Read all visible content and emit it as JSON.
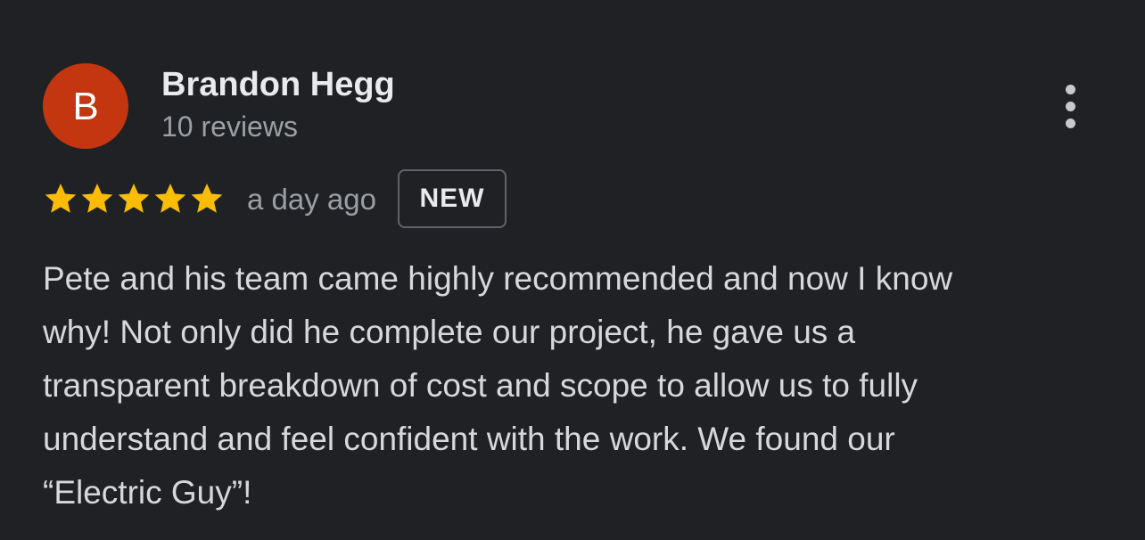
{
  "review": {
    "avatar_initial": "B",
    "reviewer_name": "Brandon Hegg",
    "review_count": "10 reviews",
    "rating": 5,
    "max_rating": 5,
    "time": "a day ago",
    "badge": "NEW",
    "text": "Pete and his team came highly recommended and now I know\nwhy! Not only did he complete our project, he gave us a\ntransparent breakdown of cost and scope to allow us to fully\nunderstand and feel confident with the work. We found our\n“Electric Guy”!"
  },
  "icons": {
    "more": "more-vertical-icon",
    "star": "star-icon"
  },
  "colors": {
    "background": "#202124",
    "avatar": "#c3360f",
    "star": "#fbbc04",
    "secondary_text": "#9aa0a6",
    "badge_border": "#5f6368"
  }
}
